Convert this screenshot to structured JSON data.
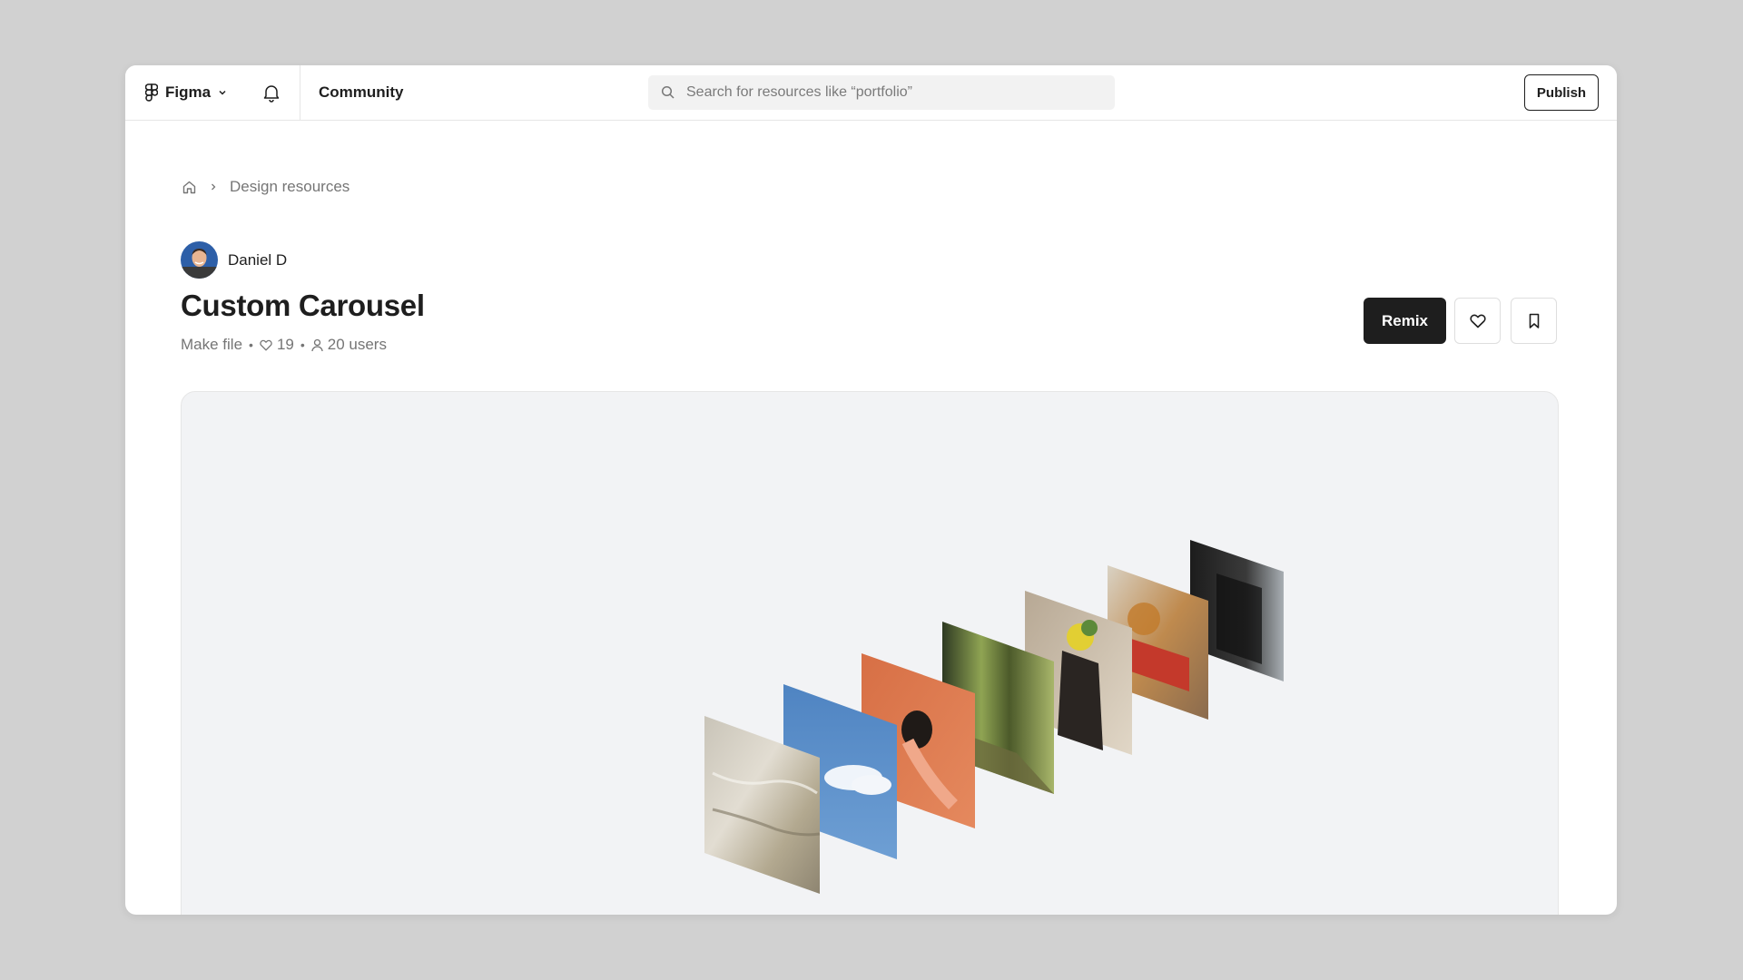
{
  "topbar": {
    "brand": "Figma",
    "community_label": "Community",
    "search_placeholder": "Search for resources like “portfolio”",
    "publish_label": "Publish",
    "icons": [
      "figma-logo-icon",
      "chevron-down-icon",
      "bell-icon",
      "search-icon"
    ]
  },
  "breadcrumb": {
    "items": [
      "Design resources"
    ],
    "icons": [
      "home-icon",
      "chevron-right-icon"
    ]
  },
  "resource": {
    "author": "Daniel D",
    "title": "Custom Carousel",
    "type": "Make file",
    "likes": "19",
    "users": "20 users"
  },
  "actions": {
    "remix_label": "Remix",
    "icons": [
      "heart-icon",
      "bookmark-icon"
    ]
  },
  "preview": {
    "cards": [
      "water-ripples-photo",
      "blue-sky-cloud-photo",
      "orange-portrait-photo",
      "forest-photo",
      "person-with-flowers-photo",
      "red-car-autumn-photo",
      "dark-building-photo"
    ]
  },
  "colors": {
    "accent_dark": "#1e1e1e",
    "muted_text": "#757575",
    "page_background": "#d1d1d1",
    "preview_background": "#f2f3f5"
  }
}
